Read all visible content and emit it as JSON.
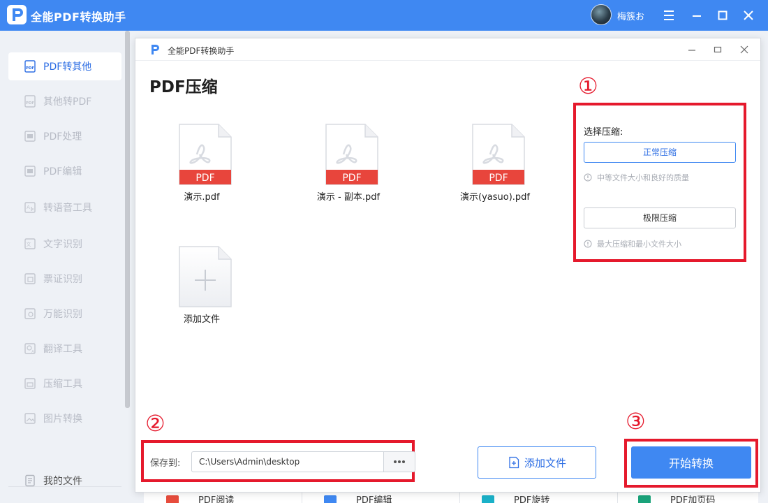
{
  "app": {
    "title": "全能PDF转换助手",
    "user_name": "梅簇お"
  },
  "sidebar": {
    "items": [
      {
        "label": "PDF转其他",
        "icon": "pdf-icon",
        "active": true
      },
      {
        "label": "其他转PDF",
        "icon": "pdf-icon"
      },
      {
        "label": "PDF处理",
        "icon": "pdf-process-icon"
      },
      {
        "label": "PDF编辑",
        "icon": "pdf-edit-icon"
      },
      {
        "label": "转语音工具",
        "icon": "voice-icon"
      },
      {
        "label": "文字识别",
        "icon": "text-ocr-icon"
      },
      {
        "label": "票证识别",
        "icon": "ticket-icon"
      },
      {
        "label": "万能识别",
        "icon": "scan-icon"
      },
      {
        "label": "翻译工具",
        "icon": "translate-icon"
      },
      {
        "label": "压缩工具",
        "icon": "compress-icon"
      },
      {
        "label": "图片转换",
        "icon": "image-icon"
      },
      {
        "label": "我的文件",
        "icon": "my-files-icon"
      }
    ]
  },
  "bottom_strip": {
    "items": [
      {
        "label": "PDF阅读",
        "color": "#e74c3c"
      },
      {
        "label": "PDF编辑",
        "color": "#3f88f2"
      },
      {
        "label": "PDF旋转",
        "color": "#1bb1c8"
      },
      {
        "label": "PDF加页码",
        "color": "#1aa37a"
      }
    ]
  },
  "dialog": {
    "title": "全能PDF转换助手",
    "page_title": "PDF压缩",
    "files": [
      {
        "name": "演示.pdf",
        "badge": "PDF"
      },
      {
        "name": "演示 - 副本.pdf",
        "badge": "PDF"
      },
      {
        "name": "演示(yasuo).pdf",
        "badge": "PDF"
      }
    ],
    "add_tile_label": "添加文件",
    "options": {
      "label": "选择压缩:",
      "normal_label": "正常压缩",
      "normal_hint": "中等文件大小和良好的质量",
      "extreme_label": "极限压缩",
      "extreme_hint": "最大压缩和最小文件大小"
    },
    "steps": {
      "one": "①",
      "two": "②",
      "three": "③"
    },
    "save": {
      "label": "保存到:",
      "path": "C:\\Users\\Admin\\desktop"
    },
    "add_file_button": "添加文件",
    "start_button": "开始转换"
  },
  "colors": {
    "brand_blue": "#3f88f2",
    "highlight_red": "#e5192c",
    "pdf_red": "#e8453c"
  }
}
